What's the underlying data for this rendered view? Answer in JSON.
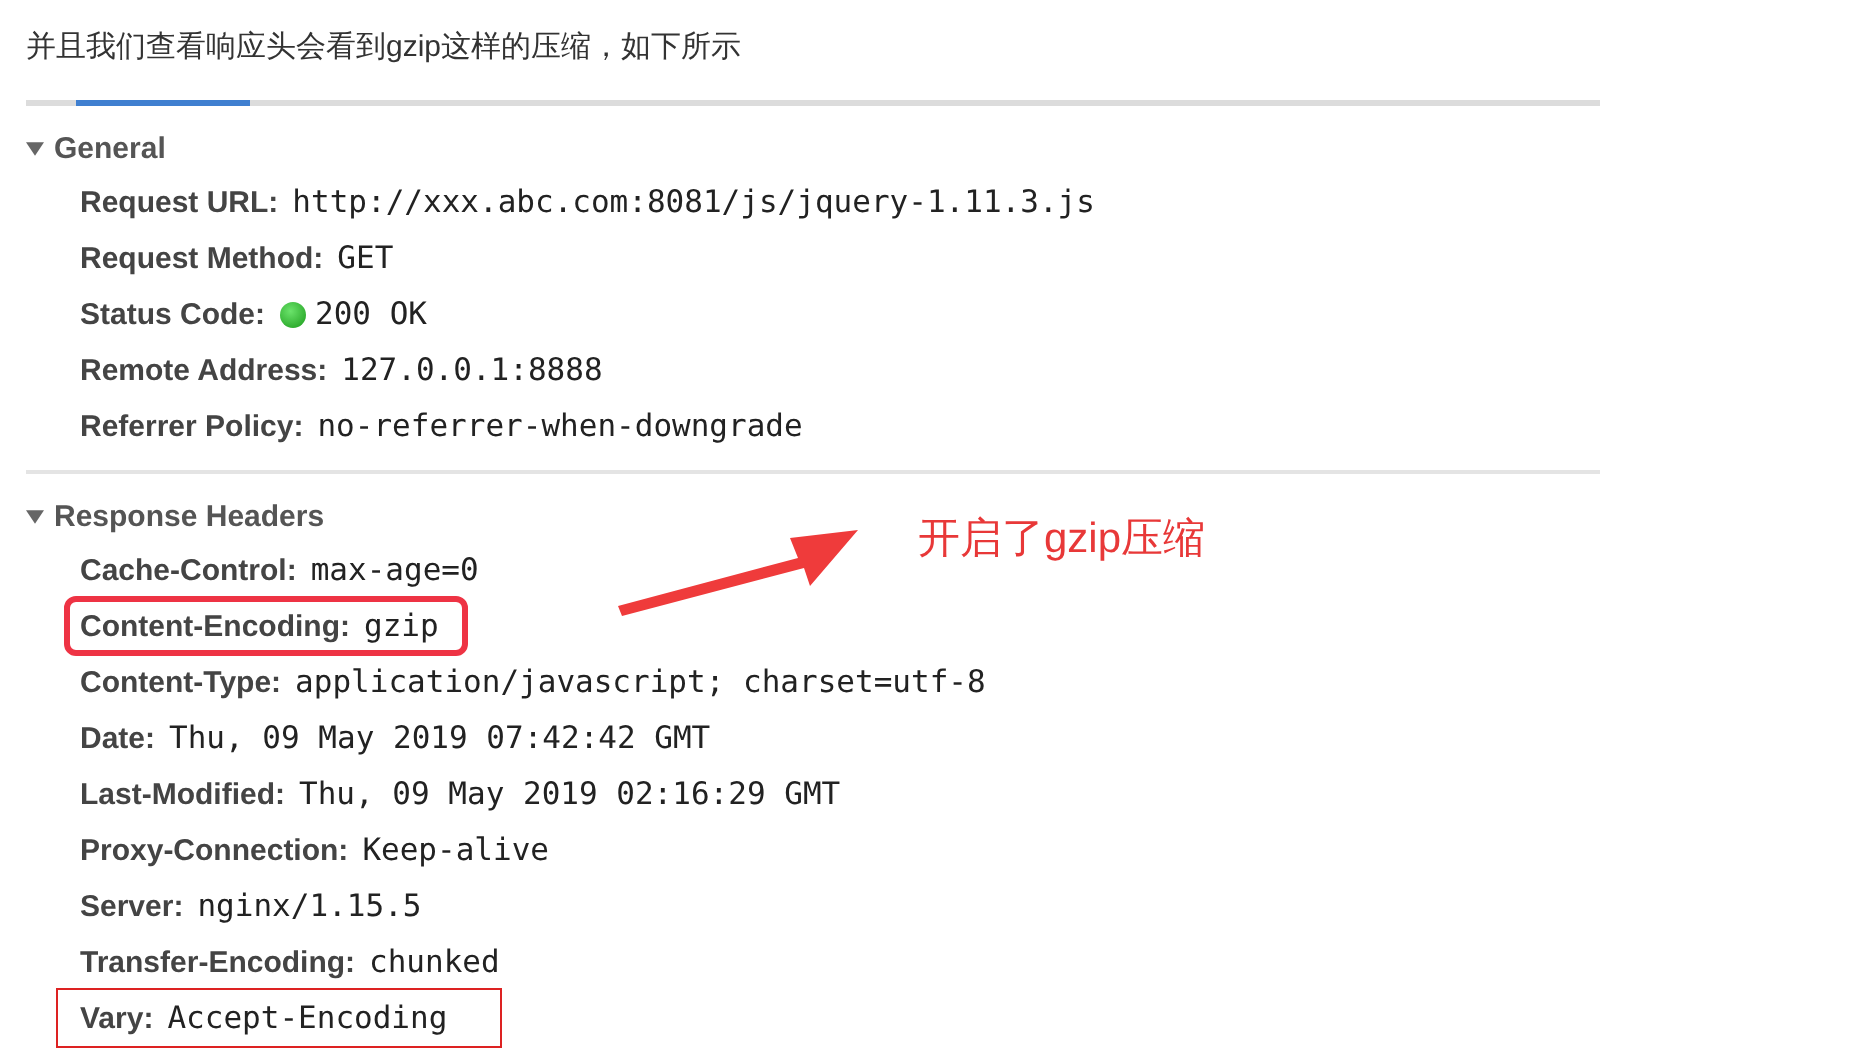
{
  "intro": "并且我们查看响应头会看到gzip这样的压缩，如下所示",
  "sections": [
    {
      "title": "General",
      "expanded": true,
      "rows": [
        {
          "name": "Request URL:",
          "value": "http://xxx.abc.com:8081/js/jquery-1.11.3.js"
        },
        {
          "name": "Request Method:",
          "value": "GET"
        },
        {
          "name": "Status Code:",
          "value": "200 OK",
          "kind": "status"
        },
        {
          "name": "Remote Address:",
          "value": "127.0.0.1:8888"
        },
        {
          "name": "Referrer Policy:",
          "value": "no-referrer-when-downgrade"
        }
      ]
    },
    {
      "title": "Response Headers",
      "expanded": true,
      "rows": [
        {
          "name": "Cache-Control:",
          "value": "max-age=0"
        },
        {
          "name": "Content-Encoding:",
          "value": "gzip",
          "kind": "rounded-frame"
        },
        {
          "name": "Content-Type:",
          "value": "application/javascript; charset=utf-8"
        },
        {
          "name": "Date:",
          "value": "Thu, 09 May 2019 07:42:42 GMT"
        },
        {
          "name": "Last-Modified:",
          "value": "Thu, 09 May 2019 02:16:29 GMT"
        },
        {
          "name": "Proxy-Connection:",
          "value": "Keep-alive"
        },
        {
          "name": "Server:",
          "value": "nginx/1.15.5"
        },
        {
          "name": "Transfer-Encoding:",
          "value": "chunked"
        },
        {
          "name": "Vary:",
          "value": "Accept-Encoding",
          "kind": "square-frame"
        }
      ]
    }
  ],
  "annotation": {
    "text": "开启了gzip压缩"
  }
}
